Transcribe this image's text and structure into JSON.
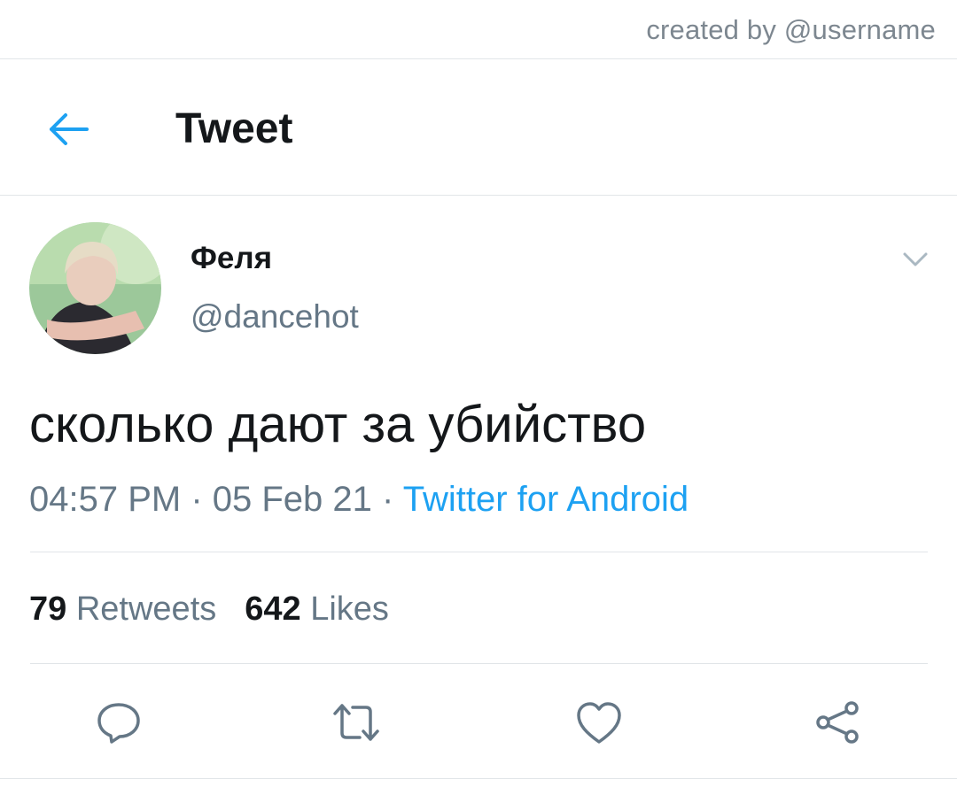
{
  "watermark": "created by @username",
  "header": {
    "back_icon": "arrow-left-icon",
    "title": "Tweet"
  },
  "tweet": {
    "author": {
      "display_name": "Феля",
      "handle": "@dancehot"
    },
    "menu_icon": "chevron-down-icon",
    "text": "сколько дают за убийство",
    "time": "04:57 PM",
    "separator": " · ",
    "date": "05 Feb 21",
    "source": "Twitter for Android",
    "stats": {
      "retweets_count": "79",
      "retweets_label": "Retweets",
      "likes_count": "642",
      "likes_label": "Likes"
    },
    "actions": [
      "reply-icon",
      "retweet-icon",
      "like-icon",
      "share-icon"
    ]
  },
  "colors": {
    "accent": "#1da1f2",
    "text_primary": "#14171a",
    "text_secondary": "#657786",
    "divider": "#e1e5e8"
  }
}
